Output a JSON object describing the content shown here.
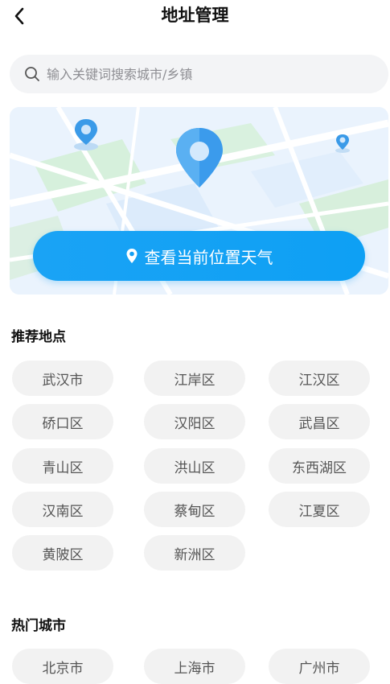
{
  "header": {
    "title": "地址管理"
  },
  "search": {
    "placeholder": "输入关键词搜索城市/乡镇"
  },
  "locate_button": {
    "label": "查看当前位置天气"
  },
  "recommended": {
    "title": "推荐地点",
    "items": [
      "武汉市",
      "江岸区",
      "江汉区",
      "硚口区",
      "汉阳区",
      "武昌区",
      "青山区",
      "洪山区",
      "东西湖区",
      "汉南区",
      "蔡甸区",
      "江夏区",
      "黄陂区",
      "新洲区"
    ]
  },
  "hot_cities": {
    "title": "热门城市",
    "items": [
      "北京市",
      "上海市",
      "广州市"
    ]
  },
  "colors": {
    "accent": "#0ea0f4",
    "chip_bg": "#f2f2f2"
  }
}
